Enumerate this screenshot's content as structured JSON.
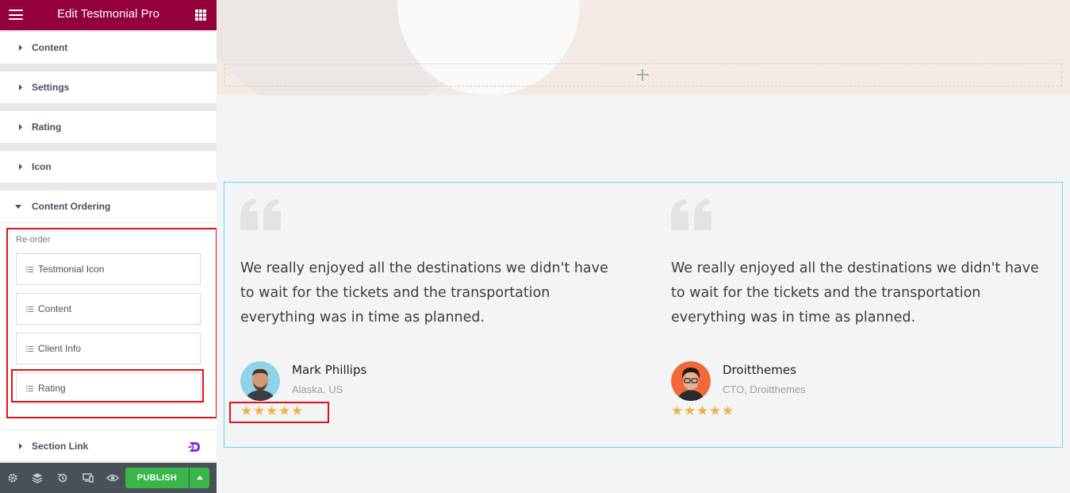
{
  "sidebar": {
    "title": "Edit Testmonial Pro",
    "sections": [
      {
        "label": "Content"
      },
      {
        "label": "Settings"
      },
      {
        "label": "Rating"
      },
      {
        "label": "Icon"
      },
      {
        "label": "Content Ordering"
      }
    ],
    "reorder": {
      "title": "Re-order",
      "items": [
        {
          "label": "Testmonial Icon"
        },
        {
          "label": "Content"
        },
        {
          "label": "Client Info"
        },
        {
          "label": "Rating"
        }
      ]
    },
    "section_link": {
      "label": "Section Link"
    },
    "footer": {
      "icons": [
        "settings-icon",
        "layers-icon",
        "history-icon",
        "responsive-icon",
        "preview-eye-icon"
      ],
      "publish_label": "PUBLISH"
    }
  },
  "testimonials": [
    {
      "text": "We really enjoyed all the destinations we didn't have to wait for the tickets and the transportation everything was in time as planned.",
      "name": "Mark Phillips",
      "role": "Alaska, US",
      "rating": 5
    },
    {
      "text": "We really enjoyed all the destinations we didn't have to wait for the tickets and the transportation everything was in time as planned.",
      "name": "Droitthemes",
      "role": "CTO, Droitthemes",
      "rating": 5
    }
  ],
  "colors": {
    "header": "#93003c",
    "publish": "#39b54a",
    "highlight": "#e0101b",
    "star": "#f2b146",
    "widget_border": "#71d7f7"
  }
}
